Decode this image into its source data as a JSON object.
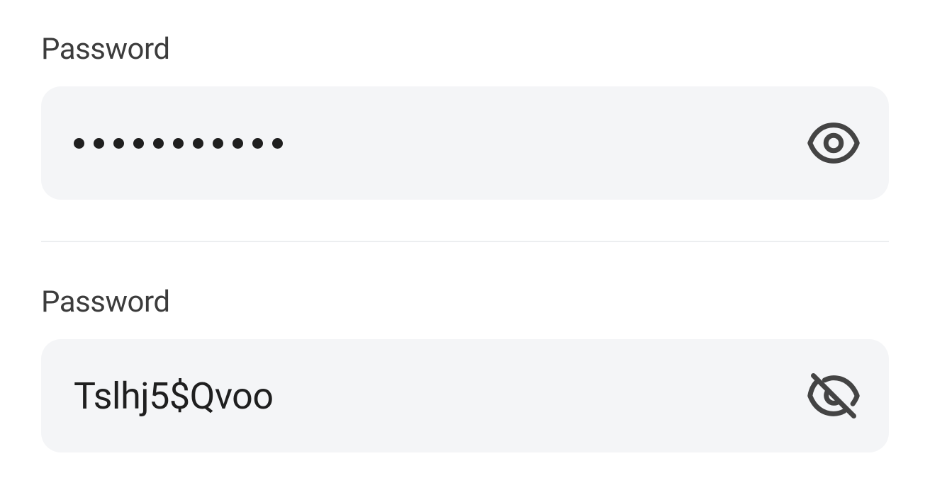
{
  "fields": [
    {
      "label": "Password",
      "value": "Tslhj5$Qvoo",
      "masked": true,
      "dotCount": 11
    },
    {
      "label": "Password",
      "value": "Tslhj5$Qvoo",
      "masked": false,
      "dotCount": 11
    }
  ]
}
